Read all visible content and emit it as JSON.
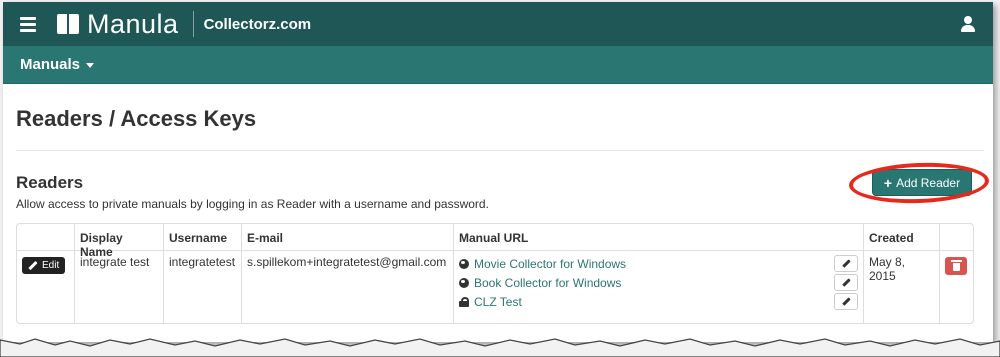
{
  "app": {
    "name": "Manula",
    "company": "Collectorz.com"
  },
  "nav": {
    "menu_label": "Manuals"
  },
  "page": {
    "title": "Readers / Access Keys"
  },
  "readers": {
    "title": "Readers",
    "description": "Allow access to private manuals by logging in as Reader with a username and password.",
    "add_button_label": "Add Reader"
  },
  "table": {
    "headers": [
      "",
      "Display Name",
      "Username",
      "E-mail",
      "Manual URL",
      "Created",
      ""
    ],
    "rows": [
      {
        "edit_label": "Edit",
        "display_name": "integrate test",
        "username": "integratetest",
        "email": "s.spillekom+integratetest@gmail.com",
        "manuals": [
          {
            "icon": "globe-icon",
            "label": "Movie Collector for Windows"
          },
          {
            "icon": "globe-icon",
            "label": "Book Collector for Windows"
          },
          {
            "icon": "lock-icon",
            "label": "CLZ Test"
          }
        ],
        "created": "May 8, 2015"
      }
    ]
  },
  "colors": {
    "topbar": "#1f5756",
    "subnav": "#2a7673",
    "accent": "#2a7673",
    "danger": "#d9534f",
    "highlight": "#e8281a"
  }
}
